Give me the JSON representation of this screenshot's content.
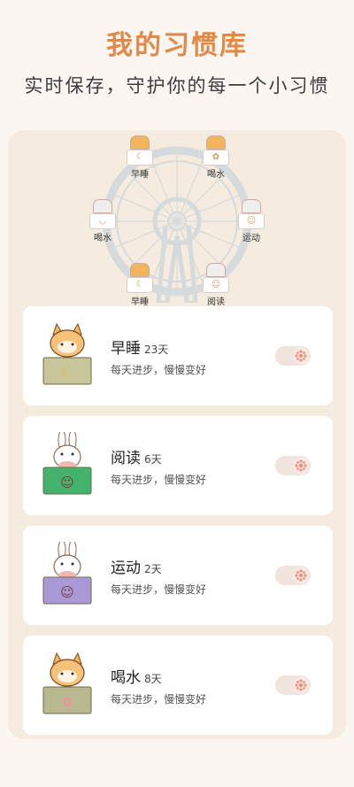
{
  "header": {
    "title": "我的习惯库",
    "subtitle": "实时保存，守护你的每一个小习惯"
  },
  "wheel": {
    "seats": [
      {
        "label": "早睡",
        "animal": "cat",
        "icon": "moon-icon"
      },
      {
        "label": "喝水",
        "animal": "cat",
        "icon": "flower-icon"
      },
      {
        "label": "运动",
        "animal": "rabbit",
        "icon": "person-icon"
      },
      {
        "label": "阅读",
        "animal": "rabbit",
        "icon": "person-icon"
      },
      {
        "label": "早睡",
        "animal": "cat",
        "icon": "moon-icon"
      },
      {
        "label": "喝水",
        "animal": "rabbit",
        "icon": "cup-icon"
      }
    ]
  },
  "habits": [
    {
      "name": "早睡",
      "days": "23天",
      "desc": "每天进步，慢慢变好",
      "animal": "cat",
      "icon": "moon-icon",
      "basket_color": "#c7c79a",
      "enabled": false
    },
    {
      "name": "阅读",
      "days": "6天",
      "desc": "每天进步，慢慢变好",
      "animal": "rabbit",
      "icon": "person-icon",
      "basket_color": "#43b26a",
      "enabled": false
    },
    {
      "name": "运动",
      "days": "2天",
      "desc": "每天进步，慢慢变好",
      "animal": "rabbit",
      "icon": "person-icon",
      "basket_color": "#a999d6",
      "enabled": false
    },
    {
      "name": "喝水",
      "days": "8天",
      "desc": "每天进步，慢慢变好",
      "animal": "cat",
      "icon": "flower-icon",
      "basket_color": "#b9b98f",
      "enabled": false
    }
  ],
  "colors": {
    "accent": "#e08a4a",
    "panel": "#f5ebde",
    "toggle_track": "#efe4de",
    "toggle_icon": "#ef8f7c"
  }
}
